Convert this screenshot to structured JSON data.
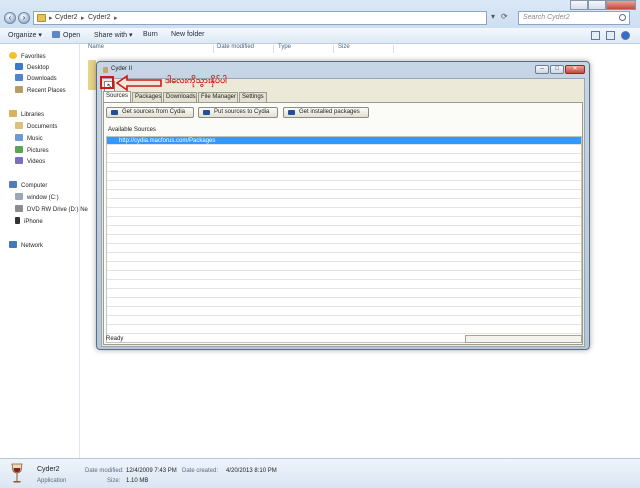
{
  "explorer": {
    "breadcrumb": [
      "Cyder2",
      "Cyder2"
    ],
    "search_placeholder": "Search Cyder2",
    "toolbar": {
      "organize": "Organize ▾",
      "open": "Open",
      "share_with": "Share with ▾",
      "burn": "Burn",
      "new_folder": "New folder"
    },
    "columns": [
      "Name",
      "Date modified",
      "Type",
      "Size"
    ],
    "nav": {
      "favorites": "Favorites",
      "favorites_items": [
        "Desktop",
        "Downloads",
        "Recent Places"
      ],
      "libraries": "Libraries",
      "libraries_items": [
        "Documents",
        "Music",
        "Pictures",
        "Videos"
      ],
      "computer": "Computer",
      "computer_items": [
        "window (C:)",
        "DVD RW Drive (D:) Ne",
        "iPhone"
      ],
      "network": "Network"
    },
    "details": {
      "name": "Cyder2",
      "type": "Application",
      "date_modified_label": "Date modified:",
      "date_modified": "12/4/2009 7:43 PM",
      "size_label": "Size:",
      "size": "1.10 MB",
      "date_created_label": "Date created:",
      "date_created": "4/20/2013 8:10 PM"
    }
  },
  "cyder": {
    "title": "Cyder II",
    "tabs": [
      "Sources",
      "Packages",
      "Downloads",
      "File Manager",
      "Settings"
    ],
    "active_tab": "Sources",
    "buttons": {
      "get_sources": "Get sources from Cydia",
      "put_sources": "Put sources to Cydia",
      "get_installed": "Get installed packages"
    },
    "list_header": "Available Sources",
    "sources": [
      "http://cydia.macforus.com/Packages"
    ],
    "status": "Ready"
  },
  "annotation": {
    "text": "ဒါလေးကိုသွားနှိပ်ပါ"
  },
  "colors": {
    "selection": "#3399ff",
    "annotation": "#d01818"
  }
}
